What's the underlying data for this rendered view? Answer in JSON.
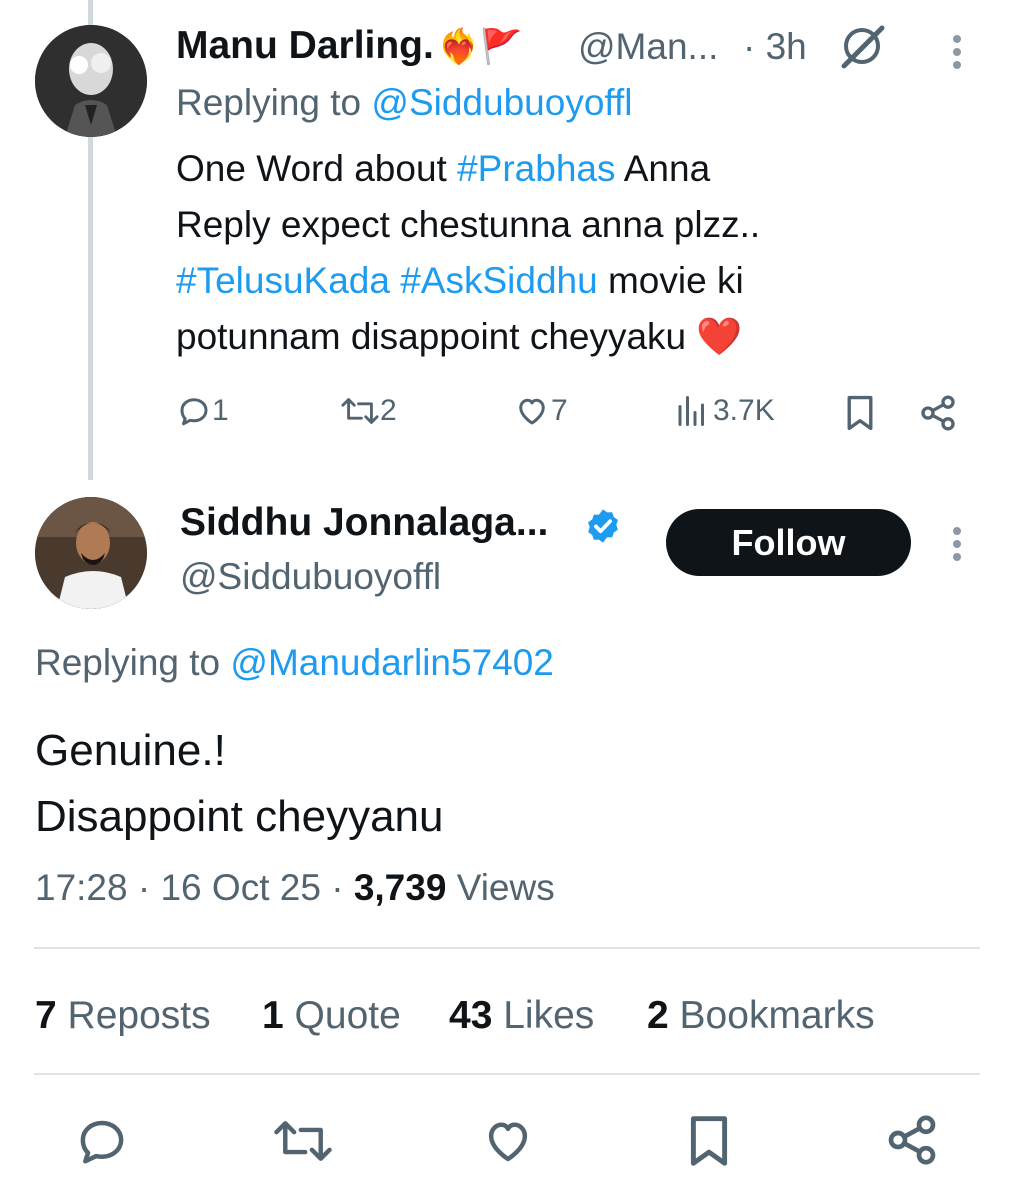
{
  "reply_tweet": {
    "display_name": "Manu Darling.",
    "emojis": "❤️‍🔥🚩",
    "handle": "@Man...",
    "time": "· 3h",
    "replying_prefix": "Replying to",
    "replying_to": "@Siddubuoyoffl",
    "text_lines": [
      {
        "pre": "One Word about ",
        "tag": "#Prabhas",
        "post": " Anna"
      },
      {
        "pre": "Reply expect chestunna anna plzz..",
        "tag": "",
        "post": ""
      },
      {
        "pre": "",
        "tag": "#TelusuKada #AskSiddhu",
        "post": " movie ki"
      },
      {
        "pre": "potunnam disappoint cheyyaku ",
        "tag": "",
        "post": "❤️"
      }
    ],
    "actions": {
      "replies": "1",
      "reposts": "2",
      "likes": "7",
      "views": "3.7K"
    },
    "icons": [
      "reply-icon",
      "repost-icon",
      "like-icon",
      "views-icon",
      "bookmark-icon",
      "share-icon",
      "grok-icon",
      "more-icon"
    ]
  },
  "main_tweet": {
    "display_name": "Siddhu Jonnalaga...",
    "verified": true,
    "handle": "@Siddubuoyoffl",
    "follow_label": "Follow",
    "replying_prefix": "Replying to",
    "replying_to": "@Manudarlin57402",
    "text_lines": [
      "Genuine.!",
      "Disappoint cheyyanu"
    ],
    "time": "17:28",
    "date": "16 Oct 25",
    "views_count": "3,739",
    "views_label": "Views",
    "stats": [
      {
        "count": "7",
        "label": "Reposts"
      },
      {
        "count": "1",
        "label": "Quote"
      },
      {
        "count": "43",
        "label": "Likes"
      },
      {
        "count": "2",
        "label": "Bookmarks"
      }
    ]
  },
  "colors": {
    "link": "#1d9bf0",
    "muted": "#536471",
    "text": "#0f1419",
    "verified": "#1d9bf0"
  }
}
